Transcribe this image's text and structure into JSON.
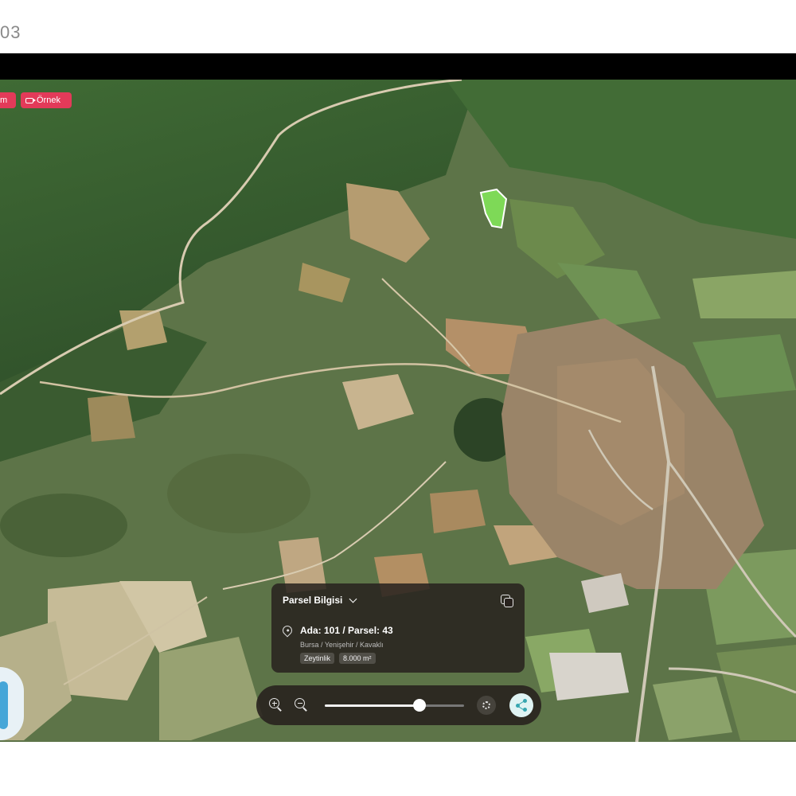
{
  "page_label": "03",
  "tags": [
    {
      "label": "m"
    },
    {
      "label": "Örnek",
      "icon": "camera-icon"
    }
  ],
  "parcel_panel": {
    "title": "Parsel Bilgisi",
    "parcel_id": "Ada: 101 / Parsel: 43",
    "address": "Bursa / Yenişehir / Kavaklı",
    "land_type": "Zeytinlik",
    "area": "8.000 m²"
  },
  "toolbar": {
    "zoom_level_fraction": 0.68
  },
  "colors": {
    "tag_accent": "#e33a59",
    "parcel_highlight": "#7ed957",
    "share_accent": "#36a6b0"
  }
}
